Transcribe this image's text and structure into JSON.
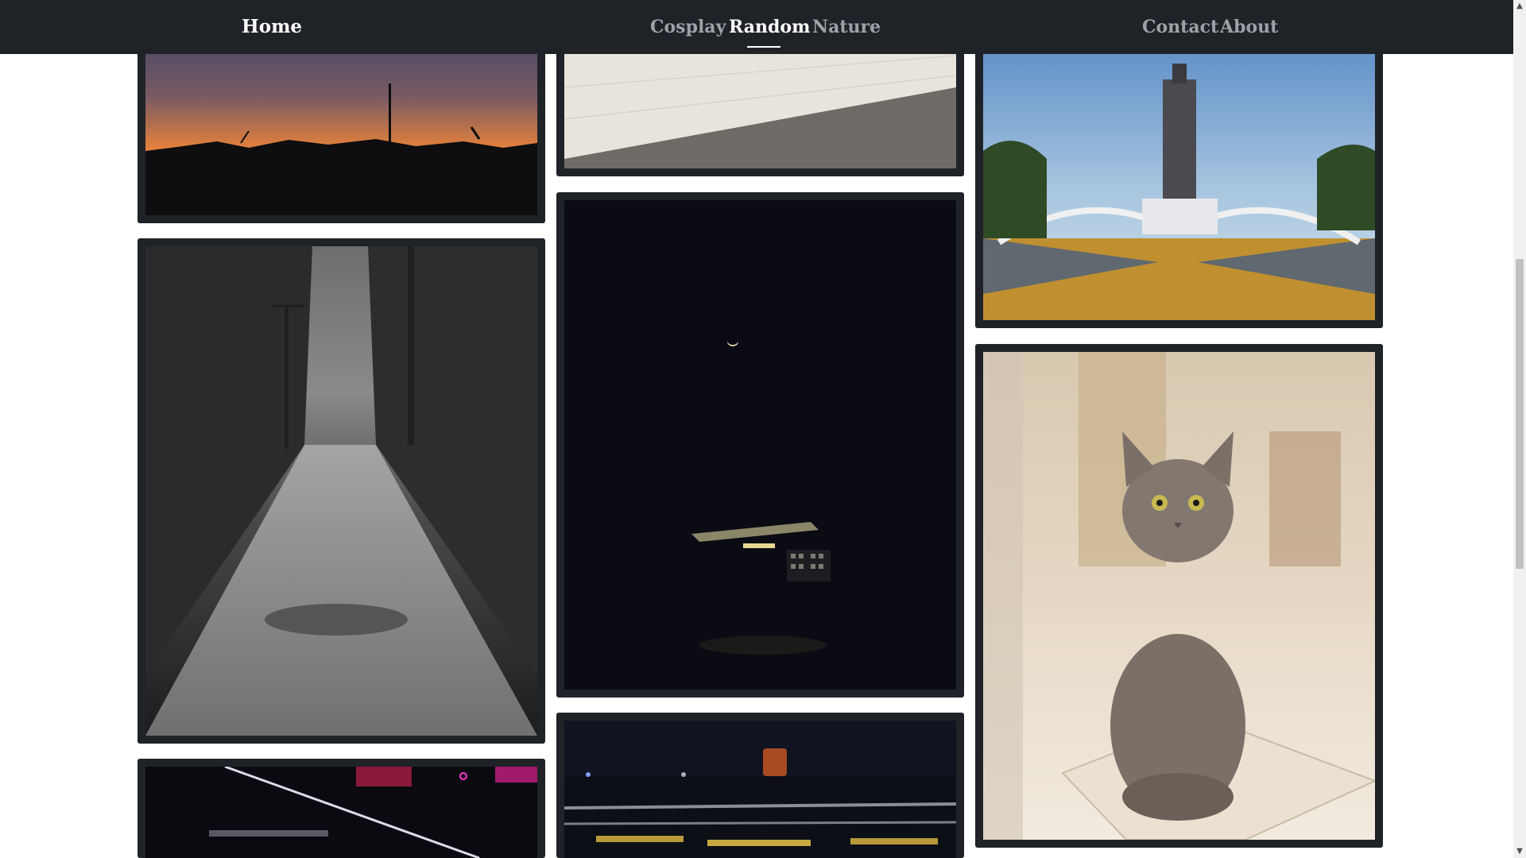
{
  "nav": {
    "home": "Home",
    "categories": [
      "Cosplay",
      "Random",
      "Nature"
    ],
    "active": "Random",
    "contact": "Contact",
    "about": "About"
  },
  "gallery": {
    "photos": [
      {
        "subject": "sunset-skyline"
      },
      {
        "subject": "wood-table"
      },
      {
        "subject": "church-tower"
      },
      {
        "subject": "rainy-street"
      },
      {
        "subject": "moon-night-house"
      },
      {
        "subject": "gray-cat"
      },
      {
        "subject": "neon-laptop"
      },
      {
        "subject": "night-railing-benches"
      }
    ]
  },
  "colors": {
    "navbar_bg": "#1f2328",
    "card_frame": "#1f2328",
    "nav_active": "#ffffff",
    "nav_inactive": "#9ea2a7"
  }
}
